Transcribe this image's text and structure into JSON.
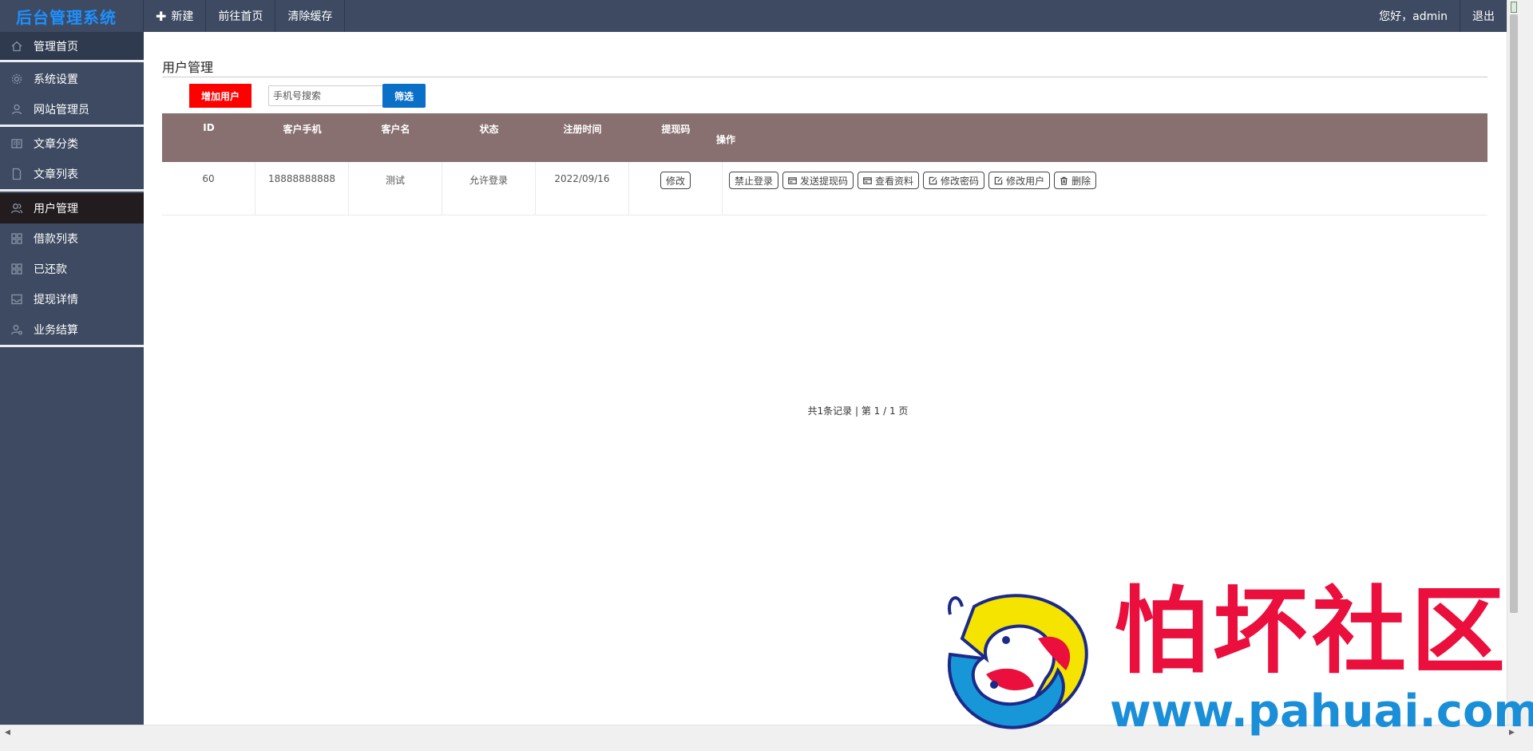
{
  "header": {
    "brand": "后台管理系统",
    "nav": [
      {
        "label": "新建",
        "icon": "plus-icon"
      },
      {
        "label": "前往首页"
      },
      {
        "label": "清除缓存"
      }
    ],
    "greeting": "您好，admin",
    "logout": "退出"
  },
  "sidebar": {
    "items": [
      {
        "label": "管理首页",
        "icon": "home-icon"
      },
      {
        "label": "系统设置",
        "icon": "gear-icon"
      },
      {
        "label": "网站管理员",
        "icon": "user-icon"
      },
      {
        "label": "文章分类",
        "icon": "book-icon"
      },
      {
        "label": "文章列表",
        "icon": "document-icon"
      },
      {
        "label": "用户管理",
        "icon": "users-icon",
        "active": true
      },
      {
        "label": "借款列表",
        "icon": "grid-icon"
      },
      {
        "label": "已还款",
        "icon": "grid-icon"
      },
      {
        "label": "提现详情",
        "icon": "inbox-icon"
      },
      {
        "label": "业务结算",
        "icon": "user-settings-icon"
      }
    ]
  },
  "main": {
    "title": "用户管理",
    "add_button": "增加用户",
    "search_placeholder": "手机号搜索",
    "filter_button": "筛选",
    "table": {
      "headers": [
        "ID",
        "客户手机",
        "客户名",
        "状态",
        "注册时间",
        "提现码",
        "操作"
      ],
      "rows": [
        {
          "id": "60",
          "phone": "18888888888",
          "name": "测试",
          "status": "允许登录",
          "reg_time": "2022/09/16",
          "code_button": "修改",
          "actions": [
            "禁止登录",
            "发送提现码",
            "查看资料",
            "修改密码",
            "修改用户",
            "删除"
          ]
        }
      ]
    },
    "pager": "共1条记录 | 第 1 / 1 页"
  },
  "watermark": {
    "text": "怕坏社区",
    "url": "www.pahuai.com"
  }
}
